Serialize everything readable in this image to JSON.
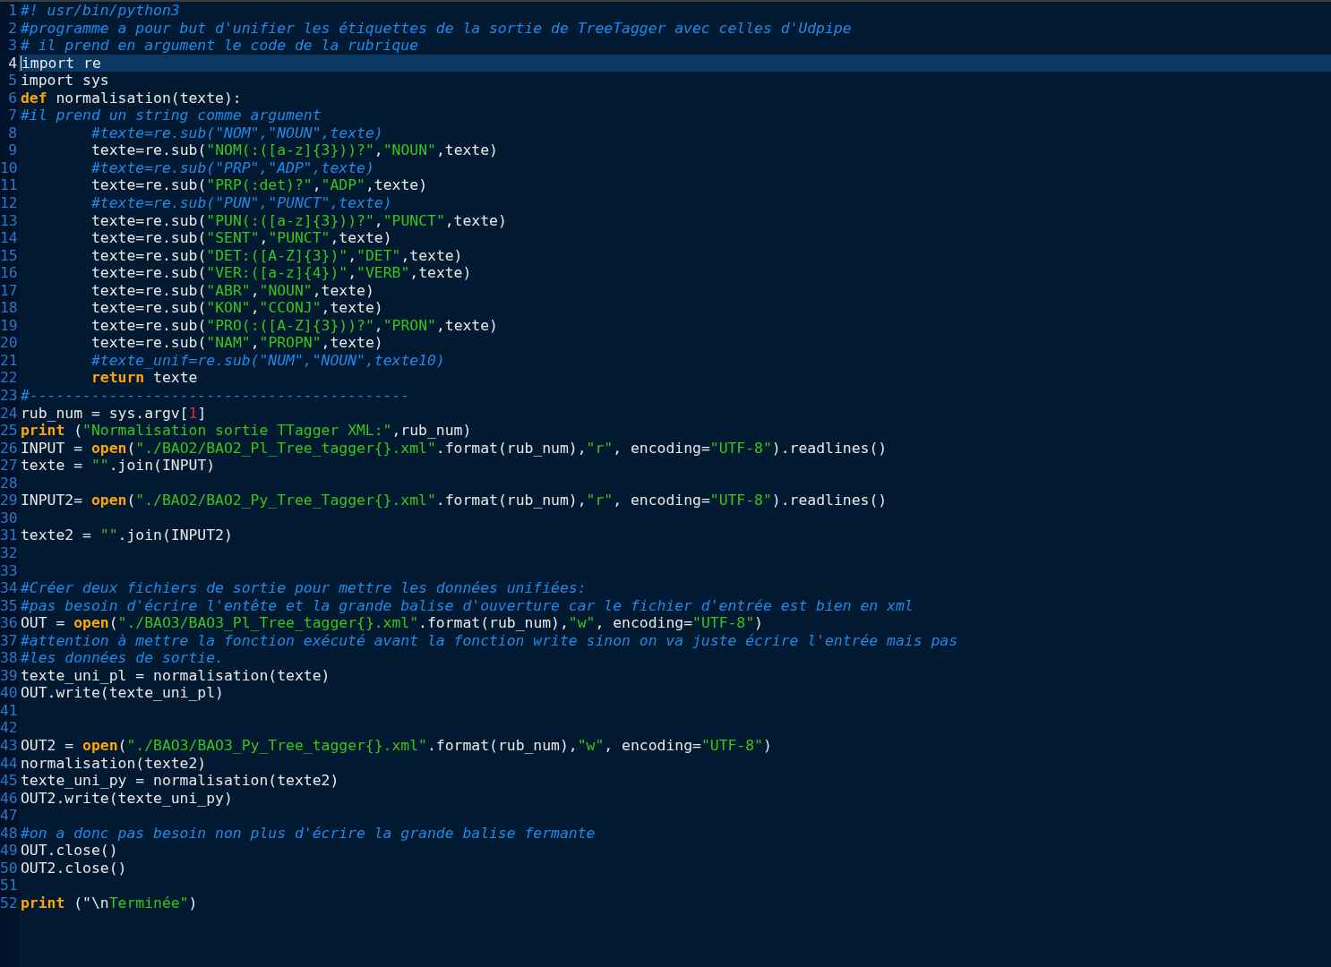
{
  "editor": {
    "lines": [
      {
        "number": "1",
        "current": false,
        "tokens": [
          {
            "kind": "comment",
            "text": "#! usr/bin/python3"
          }
        ]
      },
      {
        "number": "2",
        "current": false,
        "tokens": [
          {
            "kind": "comment",
            "text": "#programme a pour but d'unifier les étiquettes de la sortie de TreeTagger avec celles d'Udpipe"
          }
        ]
      },
      {
        "number": "3",
        "current": false,
        "tokens": [
          {
            "kind": "comment",
            "text": "# il prend en argument le code de la rubrique"
          }
        ]
      },
      {
        "number": "4",
        "current": true,
        "tokens": [
          {
            "kind": "plain",
            "text": "import re"
          }
        ]
      },
      {
        "number": "5",
        "current": false,
        "tokens": [
          {
            "kind": "plain",
            "text": "import sys"
          }
        ]
      },
      {
        "number": "6",
        "current": false,
        "tokens": [
          {
            "kind": "keyword",
            "text": "def"
          },
          {
            "kind": "plain",
            "text": " normalisation(texte):"
          }
        ]
      },
      {
        "number": "7",
        "current": false,
        "tokens": [
          {
            "kind": "comment",
            "text": "#il prend un string comme argument"
          }
        ]
      },
      {
        "number": "8",
        "current": false,
        "indent": true,
        "tokens": [
          {
            "kind": "comment",
            "text": "#texte=re.sub(\"NOM\",\"NOUN\",texte)"
          }
        ]
      },
      {
        "number": "9",
        "current": false,
        "indent": true,
        "tokens": [
          {
            "kind": "plain",
            "text": "texte=re.sub("
          },
          {
            "kind": "string",
            "text": "\"NOM(:([a-z]{3}))?\""
          },
          {
            "kind": "plain",
            "text": ","
          },
          {
            "kind": "string",
            "text": "\"NOUN\""
          },
          {
            "kind": "plain",
            "text": ",texte)"
          }
        ]
      },
      {
        "number": "10",
        "current": false,
        "indent": true,
        "tokens": [
          {
            "kind": "comment",
            "text": "#texte=re.sub(\"PRP\",\"ADP\",texte)"
          }
        ]
      },
      {
        "number": "11",
        "current": false,
        "indent": true,
        "tokens": [
          {
            "kind": "plain",
            "text": "texte=re.sub("
          },
          {
            "kind": "string",
            "text": "\"PRP(:det)?\""
          },
          {
            "kind": "plain",
            "text": ","
          },
          {
            "kind": "string",
            "text": "\"ADP\""
          },
          {
            "kind": "plain",
            "text": ",texte)"
          }
        ]
      },
      {
        "number": "12",
        "current": false,
        "indent": true,
        "tokens": [
          {
            "kind": "comment",
            "text": "#texte=re.sub(\"PUN\",\"PUNCT\",texte)"
          }
        ]
      },
      {
        "number": "13",
        "current": false,
        "indent": true,
        "tokens": [
          {
            "kind": "plain",
            "text": "texte=re.sub("
          },
          {
            "kind": "string",
            "text": "\"PUN(:([a-z]{3}))?\""
          },
          {
            "kind": "plain",
            "text": ","
          },
          {
            "kind": "string",
            "text": "\"PUNCT\""
          },
          {
            "kind": "plain",
            "text": ",texte)"
          }
        ]
      },
      {
        "number": "14",
        "current": false,
        "indent": true,
        "tokens": [
          {
            "kind": "plain",
            "text": "texte=re.sub("
          },
          {
            "kind": "string",
            "text": "\"SENT\""
          },
          {
            "kind": "plain",
            "text": ","
          },
          {
            "kind": "string",
            "text": "\"PUNCT\""
          },
          {
            "kind": "plain",
            "text": ",texte)"
          }
        ]
      },
      {
        "number": "15",
        "current": false,
        "indent": true,
        "tokens": [
          {
            "kind": "plain",
            "text": "texte=re.sub("
          },
          {
            "kind": "string",
            "text": "\"DET:([A-Z]{3})\""
          },
          {
            "kind": "plain",
            "text": ","
          },
          {
            "kind": "string",
            "text": "\"DET\""
          },
          {
            "kind": "plain",
            "text": ",texte)"
          }
        ]
      },
      {
        "number": "16",
        "current": false,
        "indent": true,
        "tokens": [
          {
            "kind": "plain",
            "text": "texte=re.sub("
          },
          {
            "kind": "string",
            "text": "\"VER:([a-z]{4})\""
          },
          {
            "kind": "plain",
            "text": ","
          },
          {
            "kind": "string",
            "text": "\"VERB\""
          },
          {
            "kind": "plain",
            "text": ",texte)"
          }
        ]
      },
      {
        "number": "17",
        "current": false,
        "indent": true,
        "tokens": [
          {
            "kind": "plain",
            "text": "texte=re.sub("
          },
          {
            "kind": "string",
            "text": "\"ABR\""
          },
          {
            "kind": "plain",
            "text": ","
          },
          {
            "kind": "string",
            "text": "\"NOUN\""
          },
          {
            "kind": "plain",
            "text": ",texte)"
          }
        ]
      },
      {
        "number": "18",
        "current": false,
        "indent": true,
        "tokens": [
          {
            "kind": "plain",
            "text": "texte=re.sub("
          },
          {
            "kind": "string",
            "text": "\"KON\""
          },
          {
            "kind": "plain",
            "text": ","
          },
          {
            "kind": "string",
            "text": "\"CCONJ\""
          },
          {
            "kind": "plain",
            "text": ",texte)"
          }
        ]
      },
      {
        "number": "19",
        "current": false,
        "indent": true,
        "tokens": [
          {
            "kind": "plain",
            "text": "texte=re.sub("
          },
          {
            "kind": "string",
            "text": "\"PRO(:([A-Z]{3}))?\""
          },
          {
            "kind": "plain",
            "text": ","
          },
          {
            "kind": "string",
            "text": "\"PRON\""
          },
          {
            "kind": "plain",
            "text": ",texte)"
          }
        ]
      },
      {
        "number": "20",
        "current": false,
        "indent": true,
        "tokens": [
          {
            "kind": "plain",
            "text": "texte=re.sub("
          },
          {
            "kind": "string",
            "text": "\"NAM\""
          },
          {
            "kind": "plain",
            "text": ","
          },
          {
            "kind": "string",
            "text": "\"PROPN\""
          },
          {
            "kind": "plain",
            "text": ",texte)"
          }
        ]
      },
      {
        "number": "21",
        "current": false,
        "indent": true,
        "tokens": [
          {
            "kind": "comment",
            "text": "#texte_unif=re.sub(\"NUM\",\"NOUN\",texte10)"
          }
        ]
      },
      {
        "number": "22",
        "current": false,
        "indent": true,
        "tokens": [
          {
            "kind": "keyword",
            "text": "return"
          },
          {
            "kind": "plain",
            "text": " texte"
          }
        ]
      },
      {
        "number": "23",
        "current": false,
        "tokens": [
          {
            "kind": "comment",
            "text": "#-------------------------------------------"
          }
        ]
      },
      {
        "number": "24",
        "current": false,
        "tokens": [
          {
            "kind": "plain",
            "text": "rub_num = sys.argv["
          },
          {
            "kind": "number",
            "text": "1"
          },
          {
            "kind": "plain",
            "text": "]"
          }
        ]
      },
      {
        "number": "25",
        "current": false,
        "tokens": [
          {
            "kind": "keyword",
            "text": "print"
          },
          {
            "kind": "plain",
            "text": " ("
          },
          {
            "kind": "string",
            "text": "\"Normalisation sortie TTagger XML:\""
          },
          {
            "kind": "plain",
            "text": ",rub_num)"
          }
        ]
      },
      {
        "number": "26",
        "current": false,
        "tokens": [
          {
            "kind": "plain",
            "text": "INPUT = "
          },
          {
            "kind": "keyword",
            "text": "open"
          },
          {
            "kind": "plain",
            "text": "("
          },
          {
            "kind": "string",
            "text": "\"./BAO2/BAO2_Pl_Tree_tagger{}.xml\""
          },
          {
            "kind": "plain",
            "text": ".format(rub_num),"
          },
          {
            "kind": "string",
            "text": "\"r\""
          },
          {
            "kind": "plain",
            "text": ", encoding="
          },
          {
            "kind": "string",
            "text": "\"UTF-8\""
          },
          {
            "kind": "plain",
            "text": ").readlines()"
          }
        ]
      },
      {
        "number": "27",
        "current": false,
        "tokens": [
          {
            "kind": "plain",
            "text": "texte = "
          },
          {
            "kind": "string",
            "text": "\"\""
          },
          {
            "kind": "plain",
            "text": ".join(INPUT)"
          }
        ]
      },
      {
        "number": "28",
        "current": false
      },
      {
        "number": "29",
        "current": false,
        "tokens": [
          {
            "kind": "plain",
            "text": "INPUT2= "
          },
          {
            "kind": "keyword",
            "text": "open"
          },
          {
            "kind": "plain",
            "text": "("
          },
          {
            "kind": "string",
            "text": "\"./BAO2/BAO2_Py_Tree_Tagger{}.xml\""
          },
          {
            "kind": "plain",
            "text": ".format(rub_num),"
          },
          {
            "kind": "string",
            "text": "\"r\""
          },
          {
            "kind": "plain",
            "text": ", encoding="
          },
          {
            "kind": "string",
            "text": "\"UTF-8\""
          },
          {
            "kind": "plain",
            "text": ").readlines()"
          }
        ]
      },
      {
        "number": "30",
        "current": false
      },
      {
        "number": "31",
        "current": false,
        "tokens": [
          {
            "kind": "plain",
            "text": "texte2 = "
          },
          {
            "kind": "string",
            "text": "\"\""
          },
          {
            "kind": "plain",
            "text": ".join(INPUT2)"
          }
        ]
      },
      {
        "number": "32",
        "current": false
      },
      {
        "number": "33",
        "current": false
      },
      {
        "number": "34",
        "current": false,
        "tokens": [
          {
            "kind": "comment",
            "text": "#Créer deux fichiers de sortie pour mettre les données unifiées:"
          }
        ]
      },
      {
        "number": "35",
        "current": false,
        "tokens": [
          {
            "kind": "comment",
            "text": "#pas besoin d'écrire l'entête et la grande balise d'ouverture car le fichier d'entrée est bien en xml"
          }
        ]
      },
      {
        "number": "36",
        "current": false,
        "tokens": [
          {
            "kind": "plain",
            "text": "OUT = "
          },
          {
            "kind": "keyword",
            "text": "open"
          },
          {
            "kind": "plain",
            "text": "("
          },
          {
            "kind": "string",
            "text": "\"./BAO3/BAO3_Pl_Tree_tagger{}.xml\""
          },
          {
            "kind": "plain",
            "text": ".format(rub_num),"
          },
          {
            "kind": "string",
            "text": "\"w\""
          },
          {
            "kind": "plain",
            "text": ", encoding="
          },
          {
            "kind": "string",
            "text": "\"UTF-8\""
          },
          {
            "kind": "plain",
            "text": ")"
          }
        ]
      },
      {
        "number": "37",
        "current": false,
        "tokens": [
          {
            "kind": "comment",
            "text": "#attention à mettre la fonction exécuté avant la fonction write sinon on va juste écrire l'entrée mais pas"
          }
        ]
      },
      {
        "number": "38",
        "current": false,
        "tokens": [
          {
            "kind": "comment",
            "text": "#les données de sortie."
          }
        ]
      },
      {
        "number": "39",
        "current": false,
        "tokens": [
          {
            "kind": "plain",
            "text": "texte_uni_pl = normalisation(texte)"
          }
        ]
      },
      {
        "number": "40",
        "current": false,
        "tokens": [
          {
            "kind": "plain",
            "text": "OUT.write(texte_uni_pl)"
          }
        ]
      },
      {
        "number": "41",
        "current": false
      },
      {
        "number": "42",
        "current": false
      },
      {
        "number": "43",
        "current": false,
        "tokens": [
          {
            "kind": "plain",
            "text": "OUT2 = "
          },
          {
            "kind": "keyword",
            "text": "open"
          },
          {
            "kind": "plain",
            "text": "("
          },
          {
            "kind": "string",
            "text": "\"./BAO3/BAO3_Py_Tree_tagger{}.xml\""
          },
          {
            "kind": "plain",
            "text": ".format(rub_num),"
          },
          {
            "kind": "string",
            "text": "\"w\""
          },
          {
            "kind": "plain",
            "text": ", encoding="
          },
          {
            "kind": "string",
            "text": "\"UTF-8\""
          },
          {
            "kind": "plain",
            "text": ")"
          }
        ]
      },
      {
        "number": "44",
        "current": false,
        "tokens": [
          {
            "kind": "plain",
            "text": "normalisation(texte2)"
          }
        ]
      },
      {
        "number": "45",
        "current": false,
        "tokens": [
          {
            "kind": "plain",
            "text": "texte_uni_py = normalisation(texte2)"
          }
        ]
      },
      {
        "number": "46",
        "current": false,
        "tokens": [
          {
            "kind": "plain",
            "text": "OUT2.write(texte_uni_py)"
          }
        ]
      },
      {
        "number": "47",
        "current": false
      },
      {
        "number": "48",
        "current": false,
        "tokens": [
          {
            "kind": "comment",
            "text": "#on a donc pas besoin non plus d'écrire la grande balise fermante"
          }
        ]
      },
      {
        "number": "49",
        "current": false,
        "tokens": [
          {
            "kind": "plain",
            "text": "OUT.close()"
          }
        ]
      },
      {
        "number": "50",
        "current": false,
        "tokens": [
          {
            "kind": "plain",
            "text": "OUT2.close()"
          }
        ]
      },
      {
        "number": "51",
        "current": false
      },
      {
        "number": "52",
        "current": false,
        "tokens": [
          {
            "kind": "keyword",
            "text": "print"
          },
          {
            "kind": "plain",
            "text": " (\"\\n"
          },
          {
            "kind": "string",
            "text": "Terminée\""
          },
          {
            "kind": "plain",
            "text": ")"
          }
        ]
      }
    ]
  }
}
